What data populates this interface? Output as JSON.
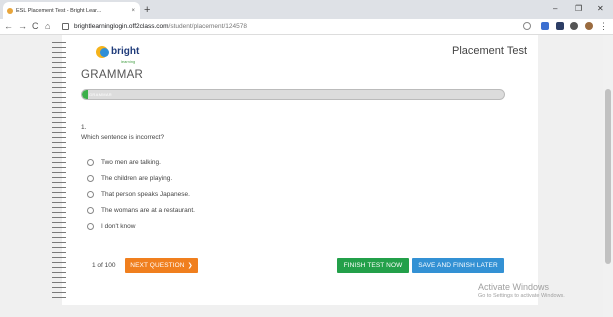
{
  "browser": {
    "tab_title": "ESL Placement Test - Bright Lear...",
    "tab_close": "×",
    "new_tab": "+",
    "win_minimize": "–",
    "win_maximize": "❐",
    "win_close": "✕",
    "nav_back": "←",
    "nav_forward": "→",
    "nav_reload": "C",
    "nav_home": "⌂",
    "url_host": "brightlearninglogin.off2class.com",
    "url_path": "/student/placement/124578",
    "menu": "⋮"
  },
  "page": {
    "logo_text": "bright",
    "logo_sub": "learning",
    "title": "Placement Test",
    "section": "GRAMMAR",
    "progress_label": "GRAMMAR",
    "progress_fraction": 0.01
  },
  "question": {
    "number": "1.",
    "text": "Which sentence is incorrect?",
    "options": [
      "Two men are talking.",
      "The children are playing.",
      "That person speaks Japanese.",
      "The womans are at a restaurant.",
      "I don't know"
    ]
  },
  "footer": {
    "counter": "1 of 100",
    "next_label": "NEXT QUESTION",
    "next_chevron": "❯",
    "finish_label": "FINISH TEST NOW",
    "save_label": "SAVE AND FINISH LATER"
  },
  "watermark": {
    "line1": "Activate Windows",
    "line2": "Go to Settings to activate Windows."
  },
  "colors": {
    "progress_fill": "#3cb04a",
    "next_button": "#f07f1e",
    "finish_button": "#23a04a",
    "save_button": "#3391d4"
  }
}
